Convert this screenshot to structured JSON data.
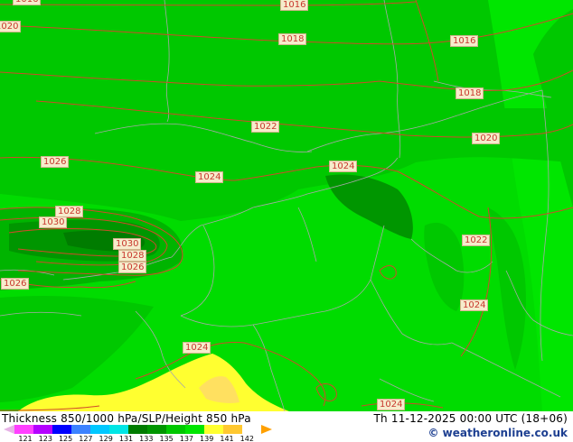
{
  "map": {
    "isobar_labels": [
      "1016",
      "1016",
      "1018",
      "1016",
      "1018",
      "1020",
      "1022",
      "1020",
      "1026",
      "1024",
      "1024",
      "1028",
      "1030",
      "1030",
      "1028",
      "1026",
      "1026",
      "1022",
      "1024",
      "1024",
      "1024"
    ],
    "colors": {
      "ocean": "#00c800",
      "land": "#00dc00",
      "eastern_band": "#00e600",
      "dark_green": "#009600",
      "deep_green": "#007c00",
      "yellow": "#ffff30",
      "orange": "#ffc830",
      "isobar": "#d04a2a",
      "border": "#a8a8a8"
    }
  },
  "footer": {
    "title": "Thickness 850/1000 hPa/SLP/Height 850 hPa",
    "time": "Th 11-12-2025 00:00 UTC (18+06)",
    "credit": "© weatheronline.co.uk",
    "scale_ticks": [
      "121",
      "123",
      "125",
      "127",
      "129",
      "131",
      "133",
      "135",
      "137",
      "139",
      "141",
      "142"
    ],
    "scale_colors": [
      "#ff40ff",
      "#b400ff",
      "#0000ff",
      "#3c82ff",
      "#00c8ff",
      "#00e6e6",
      "#007c00",
      "#009600",
      "#00c800",
      "#00e600",
      "#ffff30",
      "#ffc830",
      "#ffa000"
    ]
  }
}
